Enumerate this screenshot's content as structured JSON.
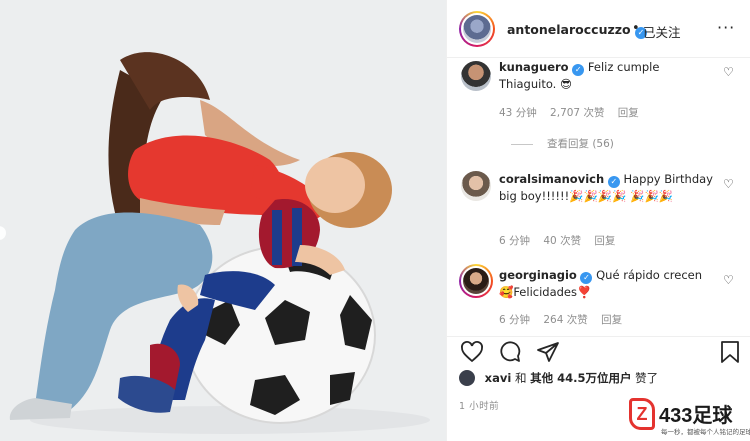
{
  "photo": {
    "alt_subject": "",
    "colors": {
      "background": "#eceeef",
      "shirt": "#e5382f",
      "jeans": "#7fa7c4",
      "ball_white": "#f7f7f7",
      "ball_black": "#1f1f1f"
    }
  },
  "header": {
    "username": "antonelaroccuzzo",
    "dot": "•",
    "follow_label": "已关注",
    "more_icon": "···"
  },
  "comments": [
    {
      "username": "kunaguero",
      "verified": true,
      "text": "Feliz cumple Thiaguito. 😎",
      "time": "43 分钟",
      "likes": "2,707 次赞",
      "reply": "回复",
      "view_replies": "查看回复 (56)"
    },
    {
      "username": "coralsimanovich",
      "verified": true,
      "text": "Happy Birthday big boy!!!!!!🎉🎉🎉🎉 🎉🎉🎉",
      "time": "6 分钟",
      "likes": "40 次赞",
      "reply": "回复"
    },
    {
      "username": "georginagio",
      "verified": true,
      "text": "Qué rápido crecen 🥰Felicidades❣️",
      "time": "6 分钟",
      "likes": "264 次赞",
      "reply": "回复"
    }
  ],
  "likes_line": {
    "user": "xavi",
    "and": "和",
    "others_label": "其他",
    "count": "44.5万",
    "suffix": "位用户",
    "action": "赞了"
  },
  "timestamp": "1 小时前",
  "watermark": {
    "logo_letter": "Z",
    "title": "433足球",
    "subtitle": "每一秒，都被每个人铭记的足球"
  },
  "icons": [
    "heart-icon",
    "comment-icon",
    "share-icon",
    "bookmark-icon",
    "verified-icon",
    "more-icon"
  ]
}
